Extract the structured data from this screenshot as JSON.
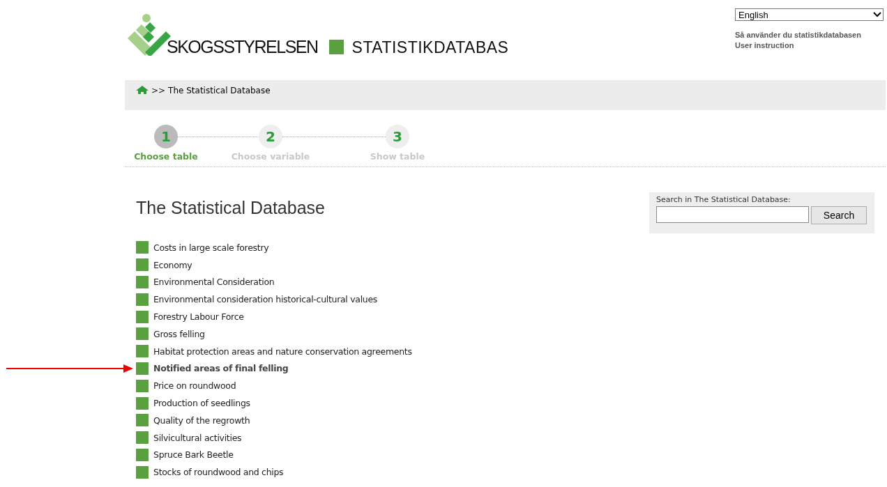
{
  "header": {
    "brand": "SKOGSSTYRELSEN",
    "product": "STATISTIKDATABAS",
    "language": {
      "value": "English"
    },
    "links": [
      "Så använder du statistikdatabasen",
      "User instruction"
    ]
  },
  "breadcrumb": {
    "separator": ">>",
    "current": "The Statistical Database"
  },
  "steps": [
    {
      "number": "1",
      "label": "Choose table",
      "selected": true
    },
    {
      "number": "2",
      "label": "Choose variable",
      "selected": false
    },
    {
      "number": "3",
      "label": "Show table",
      "selected": false
    }
  ],
  "title": "The Statistical Database",
  "search": {
    "label": "Search in The Statistical Database:",
    "button": "Search"
  },
  "tables": [
    {
      "label": "Costs in large scale forestry",
      "highlighted": false
    },
    {
      "label": "Economy",
      "highlighted": false
    },
    {
      "label": "Environmental Consideration",
      "highlighted": false
    },
    {
      "label": "Environmental consideration historical-cultural values",
      "highlighted": false
    },
    {
      "label": "Forestry Labour Force",
      "highlighted": false
    },
    {
      "label": "Gross felling",
      "highlighted": false
    },
    {
      "label": "Habitat protection areas and nature conservation agreements",
      "highlighted": false
    },
    {
      "label": "Notified areas of final felling",
      "highlighted": true
    },
    {
      "label": "Price on roundwood",
      "highlighted": false
    },
    {
      "label": "Production of seedlings",
      "highlighted": false
    },
    {
      "label": "Quality of the regrowth",
      "highlighted": false
    },
    {
      "label": "Silvicultural activities",
      "highlighted": false
    },
    {
      "label": "Spruce Bark Beetle",
      "highlighted": false
    },
    {
      "label": "Stocks of roundwood and chips",
      "highlighted": false
    }
  ]
}
